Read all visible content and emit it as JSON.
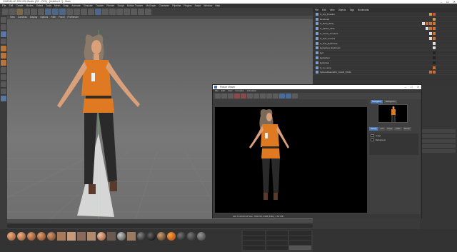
{
  "window": {
    "title": "CINEMA 4D R20.026 Studio (RC - R20) - [Untitled 1 *] - Main",
    "controls": [
      "–",
      "☐",
      "✕"
    ]
  },
  "menubar": [
    "File",
    "Edit",
    "Create",
    "Modes",
    "Select",
    "Tools",
    "Mesh",
    "Snap",
    "Animate",
    "Simulate",
    "Tracker",
    "Render",
    "Sculpt",
    "Motion Tracker",
    "MoGraph",
    "Character",
    "Pipeline",
    "Plugins",
    "Script",
    "Window",
    "Help"
  ],
  "viewport": {
    "menu": [
      "View",
      "Cameras",
      "Display",
      "Options",
      "Filter",
      "Panel",
      "ProRender"
    ]
  },
  "object_manager": {
    "tabs": [
      "File",
      "Edit",
      "View",
      "Objects",
      "Tags",
      "Bookmarks"
    ],
    "rows": [
      {
        "name": "G_Hip_Position"
      },
      {
        "name": "Rendered"
      },
      {
        "name": "G_Body_Body"
      },
      {
        "name": "G_Jacket_Shirt"
      },
      {
        "name": "G_Jeans_Trousers"
      },
      {
        "name": "G_Hair_Corona"
      },
      {
        "name": "G_Hair_Eyebrows"
      },
      {
        "name": "Eyelashes_Eyebrows"
      },
      {
        "name": "Eye"
      },
      {
        "name": "Eyelashes"
      },
      {
        "name": "Eyebrows"
      },
      {
        "name": "G_Lt_Lamp"
      },
      {
        "name": "SphereMaterialKit_CHAR_FINAL"
      }
    ]
  },
  "picture_viewer": {
    "title": "Picture Viewer",
    "controls": [
      "–",
      "☐",
      "✕"
    ],
    "menu": [
      "File",
      "Edit",
      "View",
      "Compare",
      "Animation"
    ],
    "nav_tabs": [
      "Navigator",
      "Histogram"
    ],
    "sub_tabs": [
      "History",
      "Info",
      "Layer",
      "Filter",
      "Stereo"
    ],
    "layer_rows": [
      {
        "label": "Image"
      },
      {
        "label": "Background"
      }
    ],
    "status": "100 %   00:00:22   Size: 700x700, RGB (8 Bit), 1.52 MB"
  },
  "colors": {
    "accent_blue": "#4a78b8",
    "shirt_orange": "#e07a22",
    "hair_brown": "#7a6a5a"
  }
}
